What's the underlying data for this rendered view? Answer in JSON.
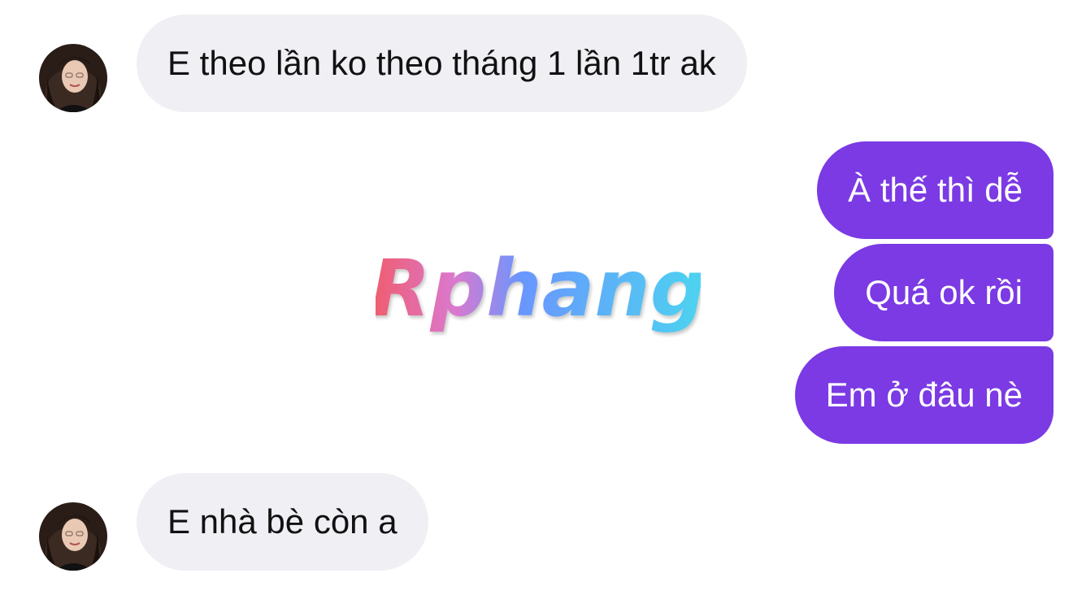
{
  "watermark": {
    "text": "Rphang"
  },
  "colors": {
    "incoming_bubble": "#efeff4",
    "outgoing_bubble": "#7b3ae4",
    "incoming_text": "#111111",
    "outgoing_text": "#ffffff"
  },
  "messages": [
    {
      "direction": "incoming",
      "text": "E theo lần ko theo tháng 1 lần 1tr ak"
    },
    {
      "direction": "outgoing",
      "text": "À thế thì dễ"
    },
    {
      "direction": "outgoing",
      "text": "Quá ok rồi"
    },
    {
      "direction": "outgoing",
      "text": "Em ở đâu nè"
    },
    {
      "direction": "incoming",
      "text": "E nhà bè còn a"
    }
  ]
}
